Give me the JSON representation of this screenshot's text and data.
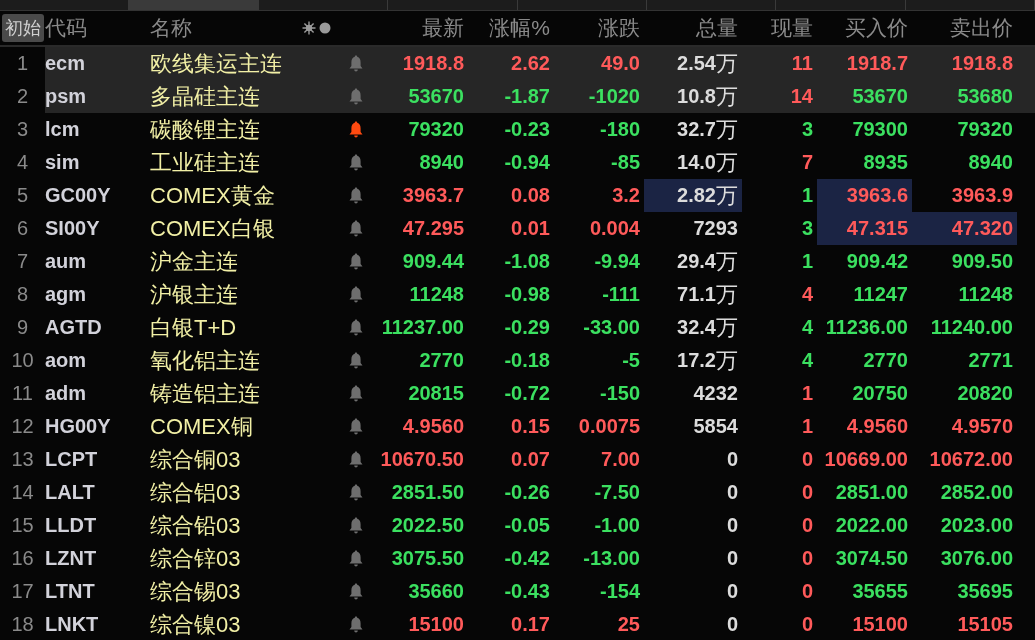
{
  "tabs": [
    {
      "selected": false
    },
    {
      "selected": true
    },
    {
      "selected": false
    },
    {
      "selected": false
    },
    {
      "selected": false
    },
    {
      "selected": false
    },
    {
      "selected": false
    },
    {
      "selected": false
    }
  ],
  "header": {
    "reset_button": "初始",
    "columns": [
      "代码",
      "名称",
      "最新",
      "涨幅%",
      "涨跌",
      "总量",
      "现量",
      "买入价",
      "卖出价"
    ]
  },
  "rows": [
    {
      "num": "1",
      "code": "ecm",
      "name": "欧线集运主连",
      "alert": false,
      "selected": true,
      "rising": true,
      "cur_rising": true,
      "vol_flash": false,
      "bid_flash": false,
      "ask_flash": false,
      "last": "1918.8",
      "pct": "2.62",
      "chg": "49.0",
      "vol": "2.54",
      "vol_unit": "万",
      "cur": "11",
      "bid": "1918.7",
      "ask": "1918.8"
    },
    {
      "num": "2",
      "code": "psm",
      "name": "多晶硅主连",
      "alert": false,
      "selected": true,
      "rising": false,
      "cur_rising": true,
      "vol_flash": false,
      "bid_flash": false,
      "ask_flash": false,
      "last": "53670",
      "pct": "-1.87",
      "chg": "-1020",
      "vol": "10.8",
      "vol_unit": "万",
      "cur": "14",
      "bid": "53670",
      "ask": "53680"
    },
    {
      "num": "3",
      "code": "lcm",
      "name": "碳酸锂主连",
      "alert": true,
      "selected": false,
      "rising": false,
      "cur_rising": false,
      "vol_flash": false,
      "bid_flash": false,
      "ask_flash": false,
      "last": "79320",
      "pct": "-0.23",
      "chg": "-180",
      "vol": "32.7",
      "vol_unit": "万",
      "cur": "3",
      "bid": "79300",
      "ask": "79320"
    },
    {
      "num": "4",
      "code": "sim",
      "name": "工业硅主连",
      "alert": false,
      "selected": false,
      "rising": false,
      "cur_rising": true,
      "vol_flash": false,
      "bid_flash": false,
      "ask_flash": false,
      "last": "8940",
      "pct": "-0.94",
      "chg": "-85",
      "vol": "14.0",
      "vol_unit": "万",
      "cur": "7",
      "bid": "8935",
      "ask": "8940"
    },
    {
      "num": "5",
      "code": "GC00Y",
      "name": "COMEX黄金",
      "alert": false,
      "selected": false,
      "rising": true,
      "cur_rising": false,
      "vol_flash": true,
      "bid_flash": true,
      "ask_flash": false,
      "last": "3963.7",
      "pct": "0.08",
      "chg": "3.2",
      "vol": "2.82",
      "vol_unit": "万",
      "cur": "1",
      "bid": "3963.6",
      "ask": "3963.9"
    },
    {
      "num": "6",
      "code": "SI00Y",
      "name": "COMEX白银",
      "alert": false,
      "selected": false,
      "rising": true,
      "cur_rising": false,
      "vol_flash": false,
      "bid_flash": true,
      "ask_flash": true,
      "last": "47.295",
      "pct": "0.01",
      "chg": "0.004",
      "vol": "7293",
      "cur": "3",
      "bid": "47.315",
      "ask": "47.320"
    },
    {
      "num": "7",
      "code": "aum",
      "name": "沪金主连",
      "alert": false,
      "selected": false,
      "rising": false,
      "cur_rising": false,
      "vol_flash": false,
      "bid_flash": false,
      "ask_flash": false,
      "last": "909.44",
      "pct": "-1.08",
      "chg": "-9.94",
      "vol": "29.4",
      "vol_unit": "万",
      "cur": "1",
      "bid": "909.42",
      "ask": "909.50"
    },
    {
      "num": "8",
      "code": "agm",
      "name": "沪银主连",
      "alert": false,
      "selected": false,
      "rising": false,
      "cur_rising": true,
      "vol_flash": false,
      "bid_flash": false,
      "ask_flash": false,
      "last": "11248",
      "pct": "-0.98",
      "chg": "-111",
      "vol": "71.1",
      "vol_unit": "万",
      "cur": "4",
      "bid": "11247",
      "ask": "11248"
    },
    {
      "num": "9",
      "code": "AGTD",
      "name": "白银T+D",
      "alert": false,
      "selected": false,
      "rising": false,
      "cur_rising": false,
      "vol_flash": false,
      "bid_flash": false,
      "ask_flash": false,
      "last": "11237.00",
      "pct": "-0.29",
      "chg": "-33.00",
      "vol": "32.4",
      "vol_unit": "万",
      "cur": "4",
      "bid": "11236.00",
      "ask": "11240.00"
    },
    {
      "num": "10",
      "code": "aom",
      "name": "氧化铝主连",
      "alert": false,
      "selected": false,
      "rising": false,
      "cur_rising": false,
      "vol_flash": false,
      "bid_flash": false,
      "ask_flash": false,
      "last": "2770",
      "pct": "-0.18",
      "chg": "-5",
      "vol": "17.2",
      "vol_unit": "万",
      "cur": "4",
      "bid": "2770",
      "ask": "2771"
    },
    {
      "num": "11",
      "code": "adm",
      "name": "铸造铝主连",
      "alert": false,
      "selected": false,
      "rising": false,
      "cur_rising": true,
      "vol_flash": false,
      "bid_flash": false,
      "ask_flash": false,
      "last": "20815",
      "pct": "-0.72",
      "chg": "-150",
      "vol": "4232",
      "cur": "1",
      "bid": "20750",
      "ask": "20820"
    },
    {
      "num": "12",
      "code": "HG00Y",
      "name": "COMEX铜",
      "alert": false,
      "selected": false,
      "rising": true,
      "cur_rising": true,
      "vol_flash": false,
      "bid_flash": false,
      "ask_flash": false,
      "last": "4.9560",
      "pct": "0.15",
      "chg": "0.0075",
      "vol": "5854",
      "cur": "1",
      "bid": "4.9560",
      "ask": "4.9570"
    },
    {
      "num": "13",
      "code": "LCPT",
      "name": "综合铜03",
      "alert": false,
      "selected": false,
      "rising": true,
      "cur_rising": true,
      "vol_flash": false,
      "bid_flash": false,
      "ask_flash": false,
      "last": "10670.50",
      "pct": "0.07",
      "chg": "7.00",
      "vol": "0",
      "cur": "0",
      "bid": "10669.00",
      "ask": "10672.00"
    },
    {
      "num": "14",
      "code": "LALT",
      "name": "综合铝03",
      "alert": false,
      "selected": false,
      "rising": false,
      "cur_rising": true,
      "vol_flash": false,
      "bid_flash": false,
      "ask_flash": false,
      "last": "2851.50",
      "pct": "-0.26",
      "chg": "-7.50",
      "vol": "0",
      "cur": "0",
      "bid": "2851.00",
      "ask": "2852.00"
    },
    {
      "num": "15",
      "code": "LLDT",
      "name": "综合铅03",
      "alert": false,
      "selected": false,
      "rising": false,
      "cur_rising": true,
      "vol_flash": false,
      "bid_flash": false,
      "ask_flash": false,
      "last": "2022.50",
      "pct": "-0.05",
      "chg": "-1.00",
      "vol": "0",
      "cur": "0",
      "bid": "2022.00",
      "ask": "2023.00"
    },
    {
      "num": "16",
      "code": "LZNT",
      "name": "综合锌03",
      "alert": false,
      "selected": false,
      "rising": false,
      "cur_rising": true,
      "vol_flash": false,
      "bid_flash": false,
      "ask_flash": false,
      "last": "3075.50",
      "pct": "-0.42",
      "chg": "-13.00",
      "vol": "0",
      "cur": "0",
      "bid": "3074.50",
      "ask": "3076.00"
    },
    {
      "num": "17",
      "code": "LTNT",
      "name": "综合锡03",
      "alert": false,
      "selected": false,
      "rising": false,
      "cur_rising": true,
      "vol_flash": false,
      "bid_flash": false,
      "ask_flash": false,
      "last": "35660",
      "pct": "-0.43",
      "chg": "-154",
      "vol": "0",
      "cur": "0",
      "bid": "35655",
      "ask": "35695"
    },
    {
      "num": "18",
      "code": "LNKT",
      "name": "综合镍03",
      "alert": false,
      "selected": false,
      "rising": true,
      "cur_rising": true,
      "vol_flash": false,
      "bid_flash": false,
      "ask_flash": false,
      "last": "15100",
      "pct": "0.17",
      "chg": "25",
      "vol": "0",
      "cur": "0",
      "bid": "15100",
      "ask": "15105"
    }
  ]
}
